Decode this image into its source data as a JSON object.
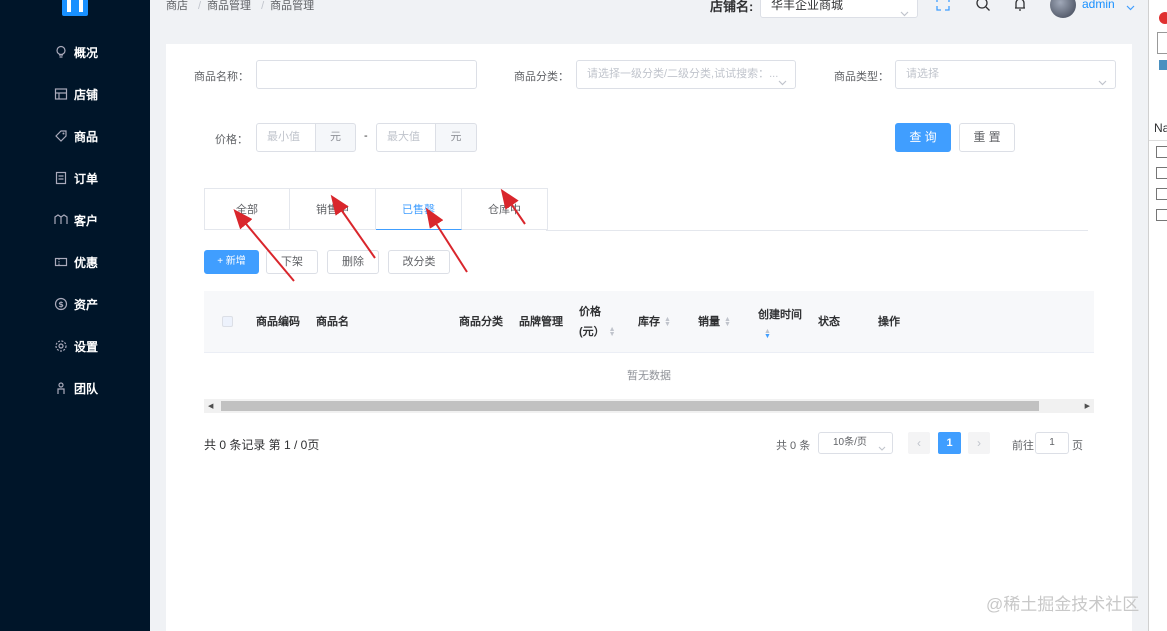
{
  "sidebar": {
    "items": [
      {
        "label": "概况",
        "icon": "bulb-icon"
      },
      {
        "label": "店铺",
        "icon": "store-icon"
      },
      {
        "label": "商品",
        "icon": "tag-icon"
      },
      {
        "label": "订单",
        "icon": "order-icon"
      },
      {
        "label": "客户",
        "icon": "customer-icon"
      },
      {
        "label": "优惠",
        "icon": "coupon-icon"
      },
      {
        "label": "资产",
        "icon": "dollar-icon"
      },
      {
        "label": "设置",
        "icon": "gear-icon"
      },
      {
        "label": "团队",
        "icon": "team-icon"
      }
    ]
  },
  "header": {
    "breadcrumb": [
      "商店",
      "商品管理",
      "商品管理"
    ],
    "shop_label": "店铺名:",
    "shop_value": "华丰企业商城",
    "user": "admin"
  },
  "filters": {
    "name_label": "商品名称：",
    "category_label": "商品分类：",
    "category_placeholder": "请选择一级分类/二级分类,试试搜索：...",
    "type_label": "商品类型：",
    "type_placeholder": "请选择",
    "price_label": "价格：",
    "min_placeholder": "最小值",
    "max_placeholder": "最大值",
    "unit": "元",
    "dash": "-",
    "search_btn": "查 询",
    "reset_btn": "重 置"
  },
  "tabs": [
    {
      "label": "全部",
      "active": false
    },
    {
      "label": "销售中",
      "active": false
    },
    {
      "label": "已售罄",
      "active": true
    },
    {
      "label": "仓库中",
      "active": false
    }
  ],
  "actions": {
    "add": "+ 新增",
    "offshelf": "下架",
    "delete": "删除",
    "recategorize": "改分类"
  },
  "table": {
    "columns": [
      "商品编码",
      "商品名",
      "商品分类",
      "品牌管理",
      "价格",
      "(元）",
      "库存",
      "销量",
      "创建时间",
      "状态",
      "操作"
    ],
    "empty_text": "暂无数据"
  },
  "pagination": {
    "summary": "共 0 条记录 第 1 / 0页",
    "total": "共 0 条",
    "page_size": "10条/页",
    "current_page": "1",
    "goto_label": "前往",
    "goto_value": "1",
    "page_suffix": "页"
  },
  "right_panel": {
    "label": "Na"
  },
  "watermark": "@稀土掘金技术社区",
  "colors": {
    "primary": "#409eff",
    "sidebar": "#001529",
    "annotation": "#d9262c"
  }
}
